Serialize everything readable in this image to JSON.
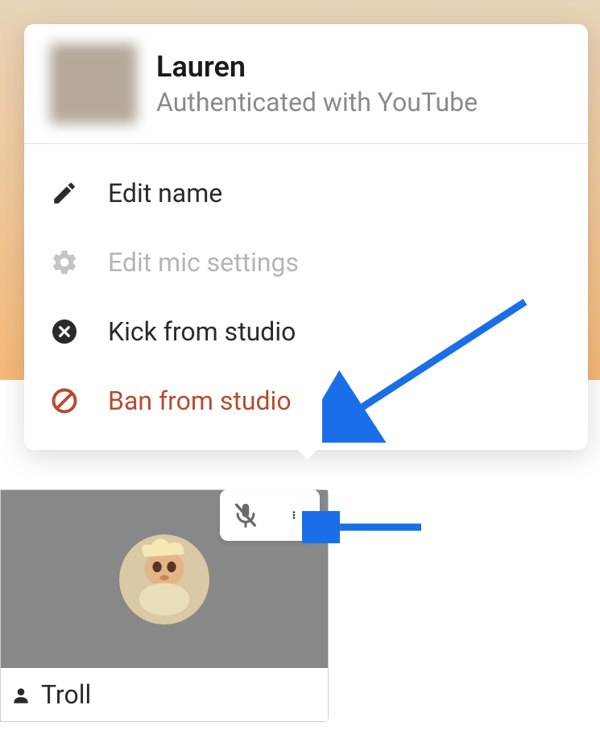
{
  "popover": {
    "user_name": "Lauren",
    "user_auth_status": "Authenticated with YouTube",
    "menu": [
      {
        "key": "edit_name",
        "label": "Edit name",
        "icon": "pencil-icon",
        "state": "normal"
      },
      {
        "key": "edit_mic",
        "label": "Edit mic settings",
        "icon": "gear-icon",
        "state": "disabled"
      },
      {
        "key": "kick",
        "label": "Kick from studio",
        "icon": "circle-x-icon",
        "state": "normal"
      },
      {
        "key": "ban",
        "label": "Ban from studio",
        "icon": "ban-icon",
        "state": "danger"
      }
    ]
  },
  "participant": {
    "name": "Troll"
  },
  "controls": {
    "mic_muted": true
  },
  "colors": {
    "danger": "#b84b2e",
    "disabled": "#b5b5b5",
    "arrow": "#1a6fe8"
  }
}
